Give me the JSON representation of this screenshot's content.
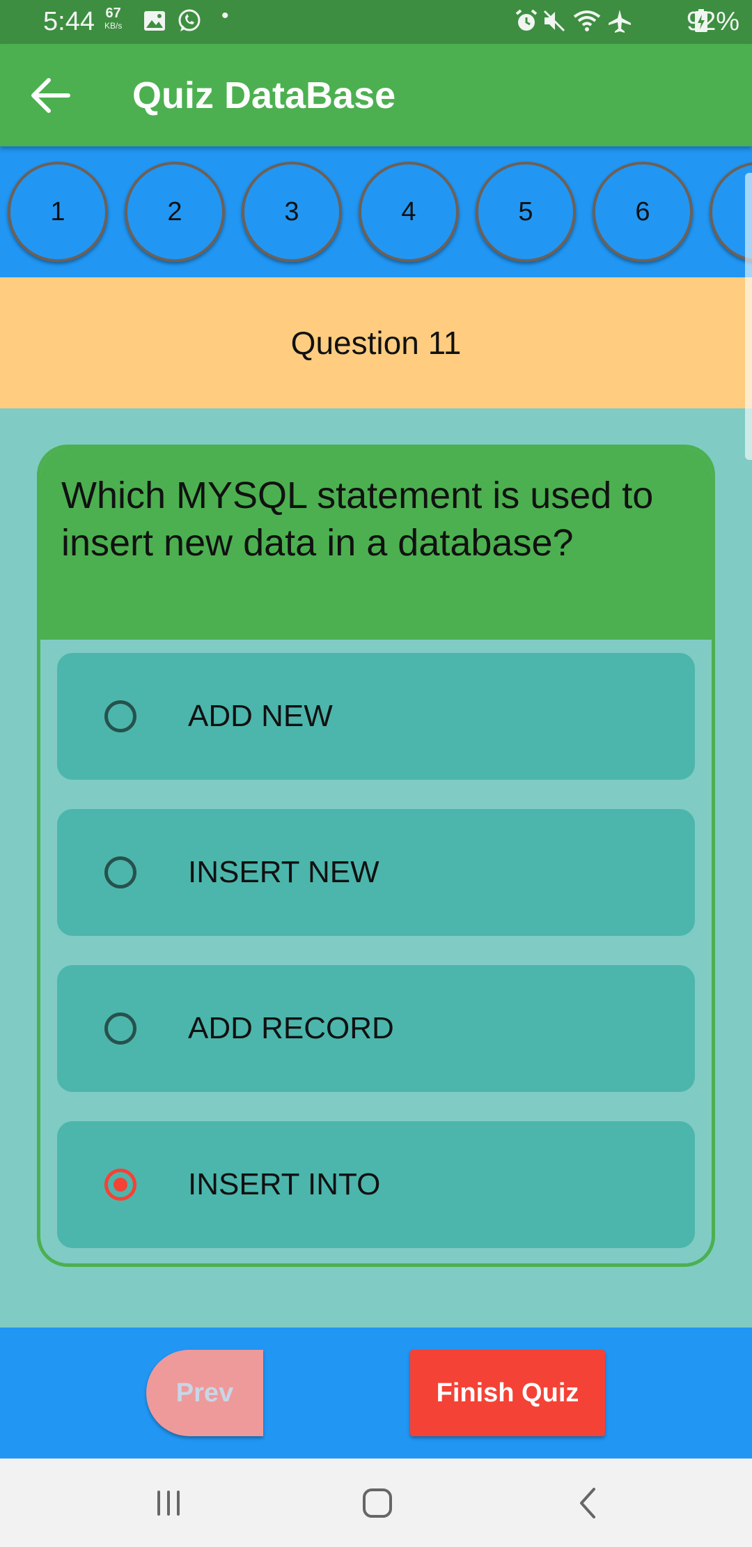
{
  "status_bar": {
    "time": "5:44",
    "net_speed_value": "67",
    "net_speed_unit": "KB/s",
    "dot": "•",
    "battery": "92%"
  },
  "app_bar": {
    "title": "Quiz DataBase"
  },
  "question_numbers": [
    "1",
    "2",
    "3",
    "4",
    "5",
    "6"
  ],
  "question_header": "Question 11",
  "question_text": "Which MYSQL statement is used to insert new data in a database?",
  "options": [
    {
      "label": "ADD NEW",
      "selected": false
    },
    {
      "label": "INSERT NEW",
      "selected": false
    },
    {
      "label": "ADD RECORD",
      "selected": false
    },
    {
      "label": "INSERT INTO",
      "selected": true
    }
  ],
  "buttons": {
    "prev": "Prev",
    "finish": "Finish Quiz"
  },
  "colors": {
    "app_bar": "#4CAF50",
    "strip": "#2196F3",
    "header": "#FFCC80",
    "background": "#80CBC4",
    "option": "#4DB6AC",
    "finish": "#F44336",
    "prev": "#EF9A9A"
  }
}
